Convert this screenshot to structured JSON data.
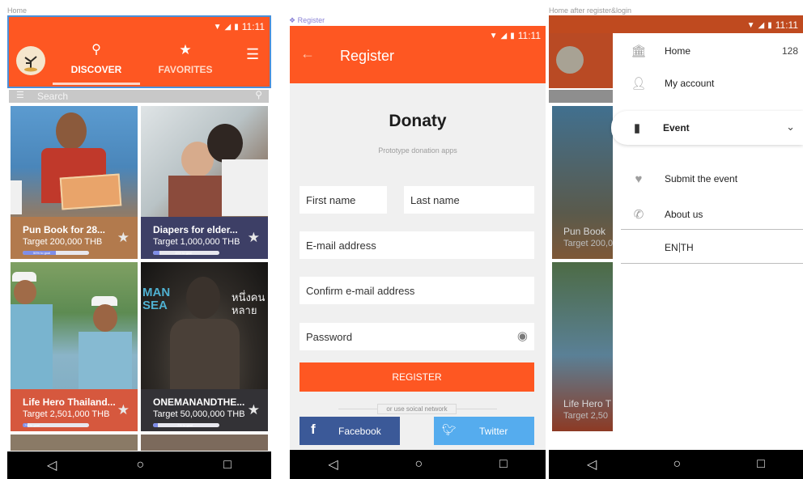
{
  "captions": {
    "home": "Home",
    "register": "❖ Register",
    "drawer": "Home after register&login"
  },
  "status": {
    "time": "11:11"
  },
  "home": {
    "tabs": [
      {
        "label": "DISCOVER"
      },
      {
        "label": "FAVORITES"
      }
    ],
    "search_placeholder": "Search",
    "cards": [
      {
        "title": "Pun Book for 28...",
        "target": "Target 200,000 THB",
        "progress_label": "50% to goal",
        "progress": 0.5,
        "panel": "#b27a4d"
      },
      {
        "title": "Diapers for elder...",
        "target": "Target 1,000,000 THB",
        "progress_label": "10% to goal",
        "progress": 0.1,
        "panel": "#3d3f66"
      },
      {
        "title": "Life Hero Thailand...",
        "target": "Target 2,501,000 THB",
        "progress_label": "7% to goal",
        "progress": 0.07,
        "panel": "#d6583e"
      },
      {
        "title": "ONEMANANDTHE...",
        "target": "Target 50,000,000 THB",
        "progress_label": "7% to goal",
        "progress": 0.07,
        "panel": "#333236"
      }
    ],
    "poster_text": {
      "left1": "MAN",
      "left2": "SEA",
      "right1": "หนึ่งคน",
      "right2": "หลาย"
    }
  },
  "register": {
    "title": "Register",
    "app_name": "Donaty",
    "tagline": "Prototype donation apps",
    "fields": {
      "first_name": "First name",
      "last_name": "Last name",
      "email": "E-mail address",
      "confirm_email": "Confirm e-mail address",
      "password": "Password"
    },
    "register_button": "REGISTER",
    "social_divider": "or use soical network",
    "facebook_label": "Facebook",
    "twitter_label": "Twitter"
  },
  "drawer": {
    "items": [
      {
        "label": "Home",
        "count": "128"
      },
      {
        "label": "My account"
      },
      {
        "label": "Event"
      },
      {
        "label": "Submit the event"
      },
      {
        "label": "About us"
      }
    ],
    "lang_en": "EN",
    "lang_th": "TH",
    "behind_cards": [
      {
        "title": "Pun Book",
        "target": "Target 200,0"
      },
      {
        "title": "Life Hero T",
        "target": "Target 2,50"
      }
    ]
  },
  "colors": {
    "accent": "#fe5722",
    "nav": "#000000",
    "facebook": "#3b5998",
    "twitter": "#55acee"
  }
}
